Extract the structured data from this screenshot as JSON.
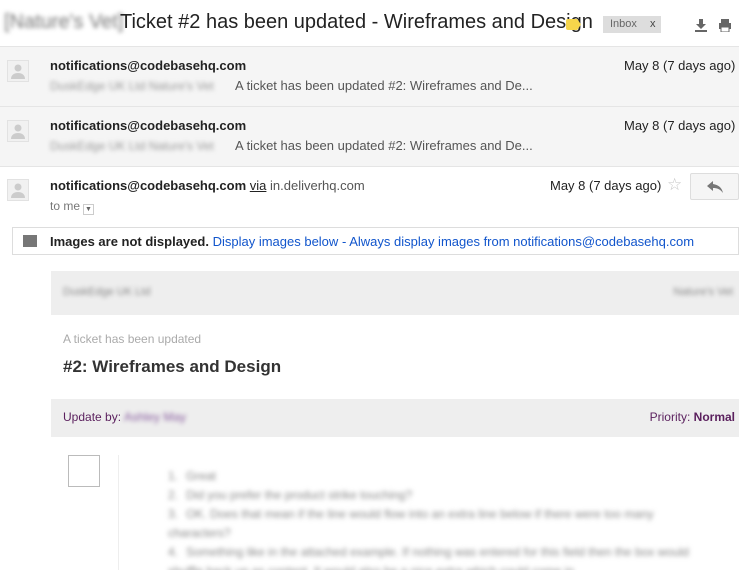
{
  "header": {
    "label": "[Nature's Vet]",
    "subject": "Ticket #2 has been updated - Wireframes and Design",
    "chip_label": "Inbox",
    "chip_close": "x",
    "tag_color": "#f6d54b"
  },
  "messages": [
    {
      "sender": "notifications@codebasehq.com",
      "snippet_blurred": "DuskEdge UK Ltd Nature's Vet",
      "snippet": "A ticket has been updated #2: Wireframes and De...",
      "date": "May 8 (7 days ago)"
    },
    {
      "sender": "notifications@codebasehq.com",
      "snippet_blurred": "DuskEdge UK Ltd Nature's Vet",
      "snippet": "A ticket has been updated #2: Wireframes and De...",
      "date": "May 8 (7 days ago)"
    }
  ],
  "open_message": {
    "sender": "notifications@codebasehq.com",
    "via": "via",
    "domain": "in.deliverhq.com",
    "to": "to me",
    "date": "May 8 (7 days ago)",
    "images_bar": {
      "notice": "Images are not displayed.",
      "display_below": "Display images below",
      "separator": "-",
      "always_display": "Always display images from notifications@codebasehq.com"
    },
    "email": {
      "header_left_blurred": "DuskEdge UK Ltd",
      "header_right_blurred": "Nature's Vet",
      "subtitle": "A ticket has been updated",
      "title": "#2: Wireframes and Design",
      "update_label": "Update by:",
      "update_author_blurred": "Ashley May",
      "priority_label": "Priority:",
      "priority_value": "Normal",
      "list_blurred": [
        {
          "num": "1.",
          "text": "Great"
        },
        {
          "num": "2.",
          "text": "Did you prefer the product strike touching?"
        },
        {
          "num": "3.",
          "text": "OK. Does that mean if the line would flow into an extra line below if there were too many characters?"
        },
        {
          "num": "4.",
          "text": "Something like in the attached example. If nothing was entered for this field then the box would shuffle back up as content. It would also be a nice extra which could come in"
        }
      ]
    }
  }
}
